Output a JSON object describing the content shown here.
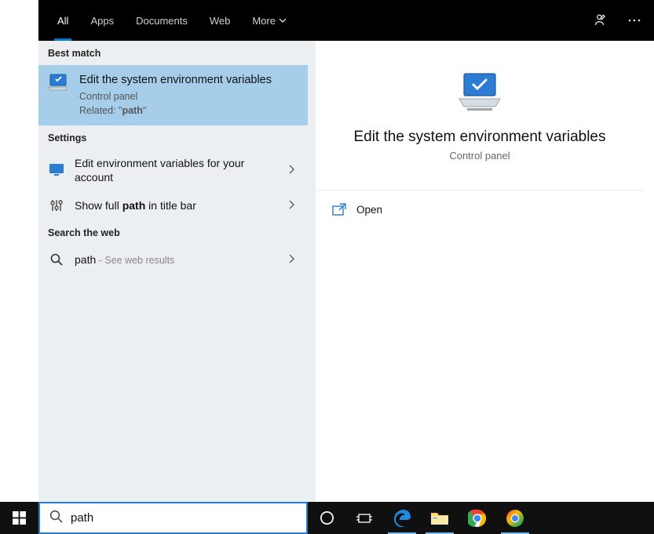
{
  "tabs": {
    "all": "All",
    "apps": "Apps",
    "documents": "Documents",
    "web": "Web",
    "more": "More"
  },
  "sections": {
    "best_match": "Best match",
    "settings": "Settings",
    "web": "Search the web"
  },
  "best_match": {
    "title": "Edit the system environment variables",
    "subtitle": "Control panel",
    "related_prefix": "Related: \"",
    "related_term": "path",
    "related_suffix": "\""
  },
  "settings_items": [
    {
      "pre": "Edit environment variables for your account",
      "bold": "",
      "post": ""
    },
    {
      "pre": "Show full ",
      "bold": "path",
      "post": " in title bar"
    }
  ],
  "web_item": {
    "term": "path",
    "suffix": " - See web results"
  },
  "detail": {
    "title": "Edit the system environment variables",
    "subtitle": "Control panel",
    "open": "Open"
  },
  "search": {
    "value": "path"
  }
}
